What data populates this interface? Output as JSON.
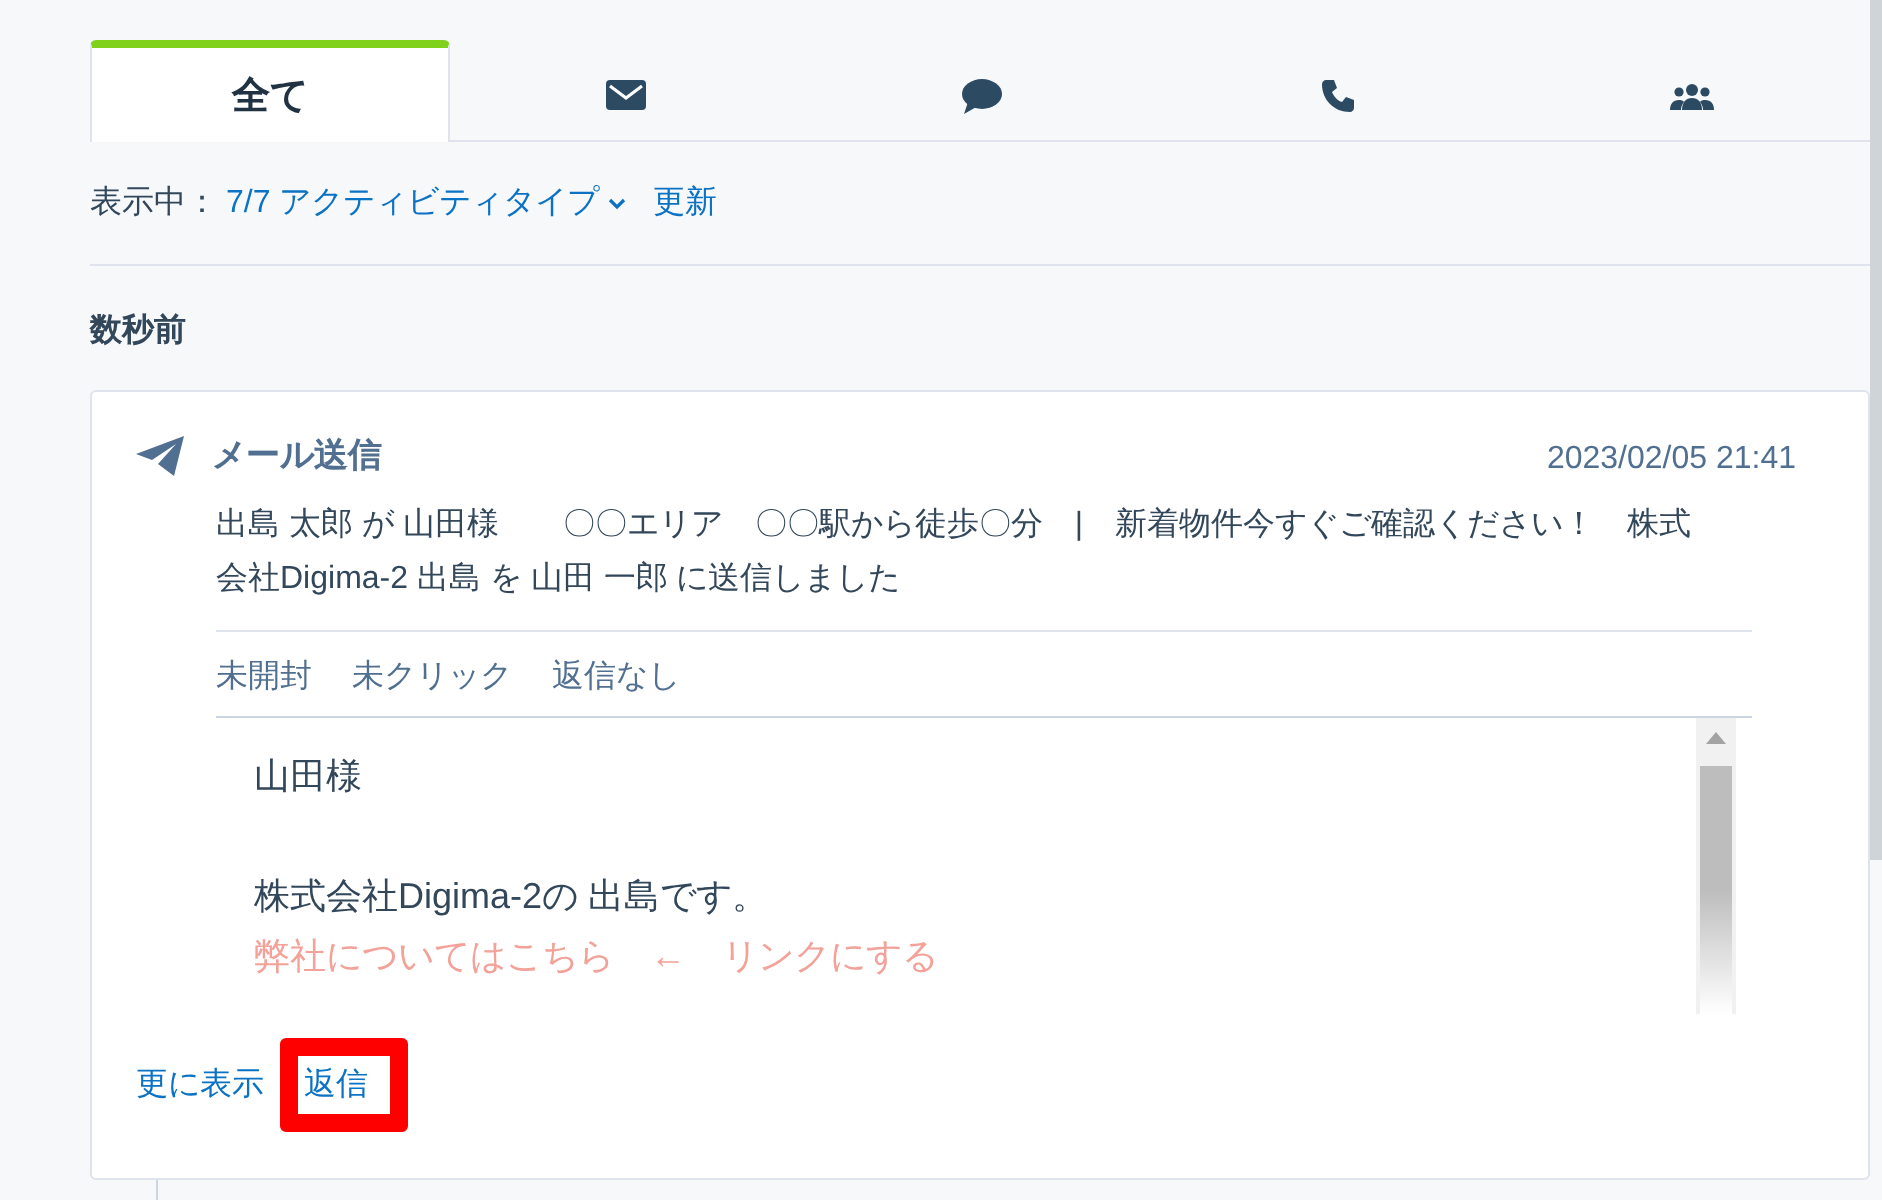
{
  "tabs": [
    {
      "kind": "all",
      "label": "全て",
      "selected": true
    },
    {
      "kind": "email",
      "selected": false
    },
    {
      "kind": "chat",
      "selected": false
    },
    {
      "kind": "call",
      "selected": false
    },
    {
      "kind": "meeting",
      "selected": false
    }
  ],
  "filter": {
    "label": "表示中：",
    "value": "7/7 アクティビティタイプ",
    "refresh": "更新"
  },
  "group_heading": "数秒前",
  "activity": {
    "title": "メール送信",
    "timestamp": "2023/02/05 21:41",
    "summary": "出島 太郎 が 山田様　　〇〇エリア　〇〇駅から徒歩〇分　|　新着物件今すぐご確認ください！　株式会社Digima-2 出島 を 山田 一郎 に送信しました",
    "statuses": [
      "未開封",
      "未クリック",
      "返信なし"
    ],
    "email_lines": [
      {
        "kind": "text",
        "text": "山田様"
      },
      {
        "kind": "blank"
      },
      {
        "kind": "text",
        "text": "株式会社Digima-2の 出島です。"
      },
      {
        "kind": "note",
        "text": "弊社についてはこちら　←　リンクにする"
      }
    ],
    "actions": [
      {
        "label": "更に表示",
        "highlighted": false
      },
      {
        "label": "返信",
        "highlighted": true
      }
    ]
  }
}
